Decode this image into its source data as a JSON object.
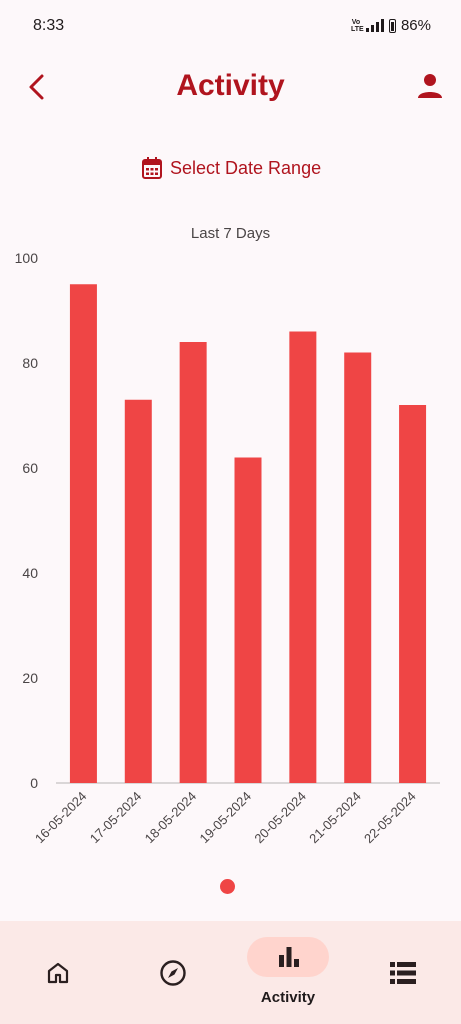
{
  "status_bar": {
    "time": "8:33",
    "network": "Vo LTE",
    "battery": "86%"
  },
  "header": {
    "title": "Activity"
  },
  "date_range": {
    "label": "Select Date Range"
  },
  "chart_data": {
    "type": "bar",
    "title": "Last 7 Days",
    "categories": [
      "16-05-2024",
      "17-05-2024",
      "18-05-2024",
      "19-05-2024",
      "20-05-2024",
      "21-05-2024",
      "22-05-2024"
    ],
    "values": [
      95,
      73,
      84,
      62,
      86,
      82,
      72
    ],
    "ylim": [
      0,
      100
    ],
    "yticks": [
      0,
      20,
      40,
      60,
      80,
      100
    ],
    "xlabel": "",
    "ylabel": "",
    "grid": false,
    "bar_color": "#ef4545"
  },
  "pager": {
    "count": 1,
    "active": 0
  },
  "bottom_nav": {
    "items": [
      {
        "icon": "home-icon"
      },
      {
        "icon": "compass-icon"
      },
      {
        "icon": "bar-chart-icon",
        "label": "Activity",
        "active": true
      },
      {
        "icon": "list-icon"
      }
    ]
  },
  "colors": {
    "primary": "#b0141e",
    "bar": "#ef4545",
    "nav_bg": "#fbe9e7",
    "nav_active": "#ffd4cd",
    "background": "#fdf8fa"
  }
}
